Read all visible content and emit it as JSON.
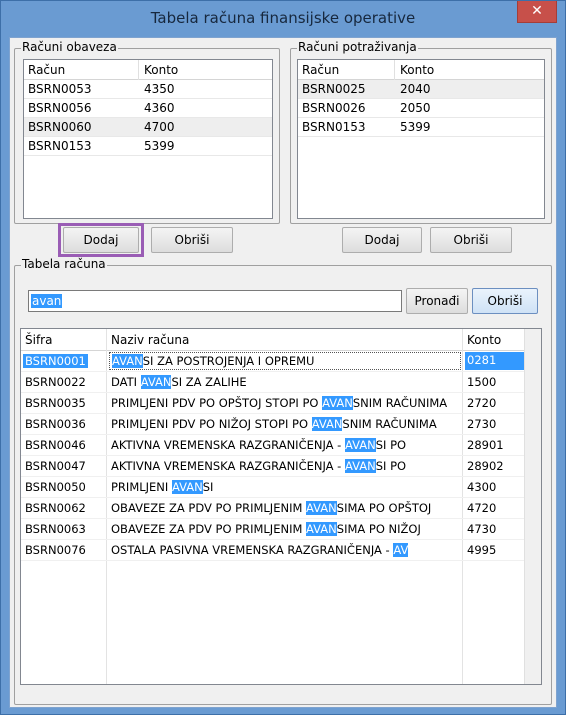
{
  "window": {
    "title": "Tabela računa finansijske operative",
    "close_glyph": "✕"
  },
  "obaveze": {
    "legend": "Računi obaveza",
    "col_racun": "Račun",
    "col_konto": "Konto",
    "rows": [
      {
        "racun": "BSRN0053",
        "konto": "4350"
      },
      {
        "racun": "BSRN0056",
        "konto": "4360"
      },
      {
        "racun": "BSRN0060",
        "konto": "4700"
      },
      {
        "racun": "BSRN0153",
        "konto": "5399"
      }
    ],
    "add_label": "Dodaj",
    "delete_label": "Obriši"
  },
  "potrazivanja": {
    "legend": "Računi potraživanja",
    "col_racun": "Račun",
    "col_konto": "Konto",
    "rows": [
      {
        "racun": "BSRN0025",
        "konto": "2040"
      },
      {
        "racun": "BSRN0026",
        "konto": "2050"
      },
      {
        "racun": "BSRN0153",
        "konto": "5399"
      }
    ],
    "add_label": "Dodaj",
    "delete_label": "Obriši"
  },
  "tabela": {
    "legend": "Tabela računa",
    "search_value": "avan",
    "find_label": "Pronađi",
    "clear_label": "Obriši",
    "col_sifra": "Šifra",
    "col_naziv": "Naziv računa",
    "col_konto": "Konto",
    "rows": [
      {
        "sifra": "BSRN0001",
        "pre": "",
        "match": "AVAN",
        "post": "SI ZA POSTROJENJA I OPREMU",
        "konto": "0281"
      },
      {
        "sifra": "BSRN0022",
        "pre": "DATI ",
        "match": "AVAN",
        "post": "SI ZA ZALIHE",
        "konto": "1500"
      },
      {
        "sifra": "BSRN0035",
        "pre": "PRIMLJENI PDV PO OPŠTOJ STOPI PO ",
        "match": "AVAN",
        "post": "SNIM RAČUNIMA",
        "konto": "2720"
      },
      {
        "sifra": "BSRN0036",
        "pre": "PRIMLJENI PDV PO NIŽOJ STOPI PO ",
        "match": "AVAN",
        "post": "SNIM RAČUNIMA",
        "konto": "2730"
      },
      {
        "sifra": "BSRN0046",
        "pre": "AKTIVNA VREMENSKA RAZGRANIČENJA - ",
        "match": "AVAN",
        "post": "SI PO",
        "konto": "28901"
      },
      {
        "sifra": "BSRN0047",
        "pre": "AKTIVNA VREMENSKA RAZGRANIČENJA - ",
        "match": "AVAN",
        "post": "SI PO",
        "konto": "28902"
      },
      {
        "sifra": "BSRN0050",
        "pre": "PRIMLJENI ",
        "match": "AVAN",
        "post": "SI",
        "konto": "4300"
      },
      {
        "sifra": "BSRN0062",
        "pre": "OBAVEZE ZA PDV PO PRIMLJENIM ",
        "match": "AVAN",
        "post": "SIMA PO OPŠTOJ",
        "konto": "4720"
      },
      {
        "sifra": "BSRN0063",
        "pre": "OBAVEZE ZA PDV PO PRIMLJENIM ",
        "match": "AVAN",
        "post": "SIMA PO NIŽOJ",
        "konto": "4730"
      },
      {
        "sifra": "BSRN0076",
        "pre": "OSTALA PASIVNA VREMENSKA RAZGRANIČENJA - ",
        "match": "AV",
        "post": "",
        "konto": "4995"
      }
    ]
  },
  "colors": {
    "title_bg": "#6a9bd2",
    "selection": "#3399ff",
    "focus_frame": "#9a5db5",
    "close_bg": "#c7504a"
  }
}
